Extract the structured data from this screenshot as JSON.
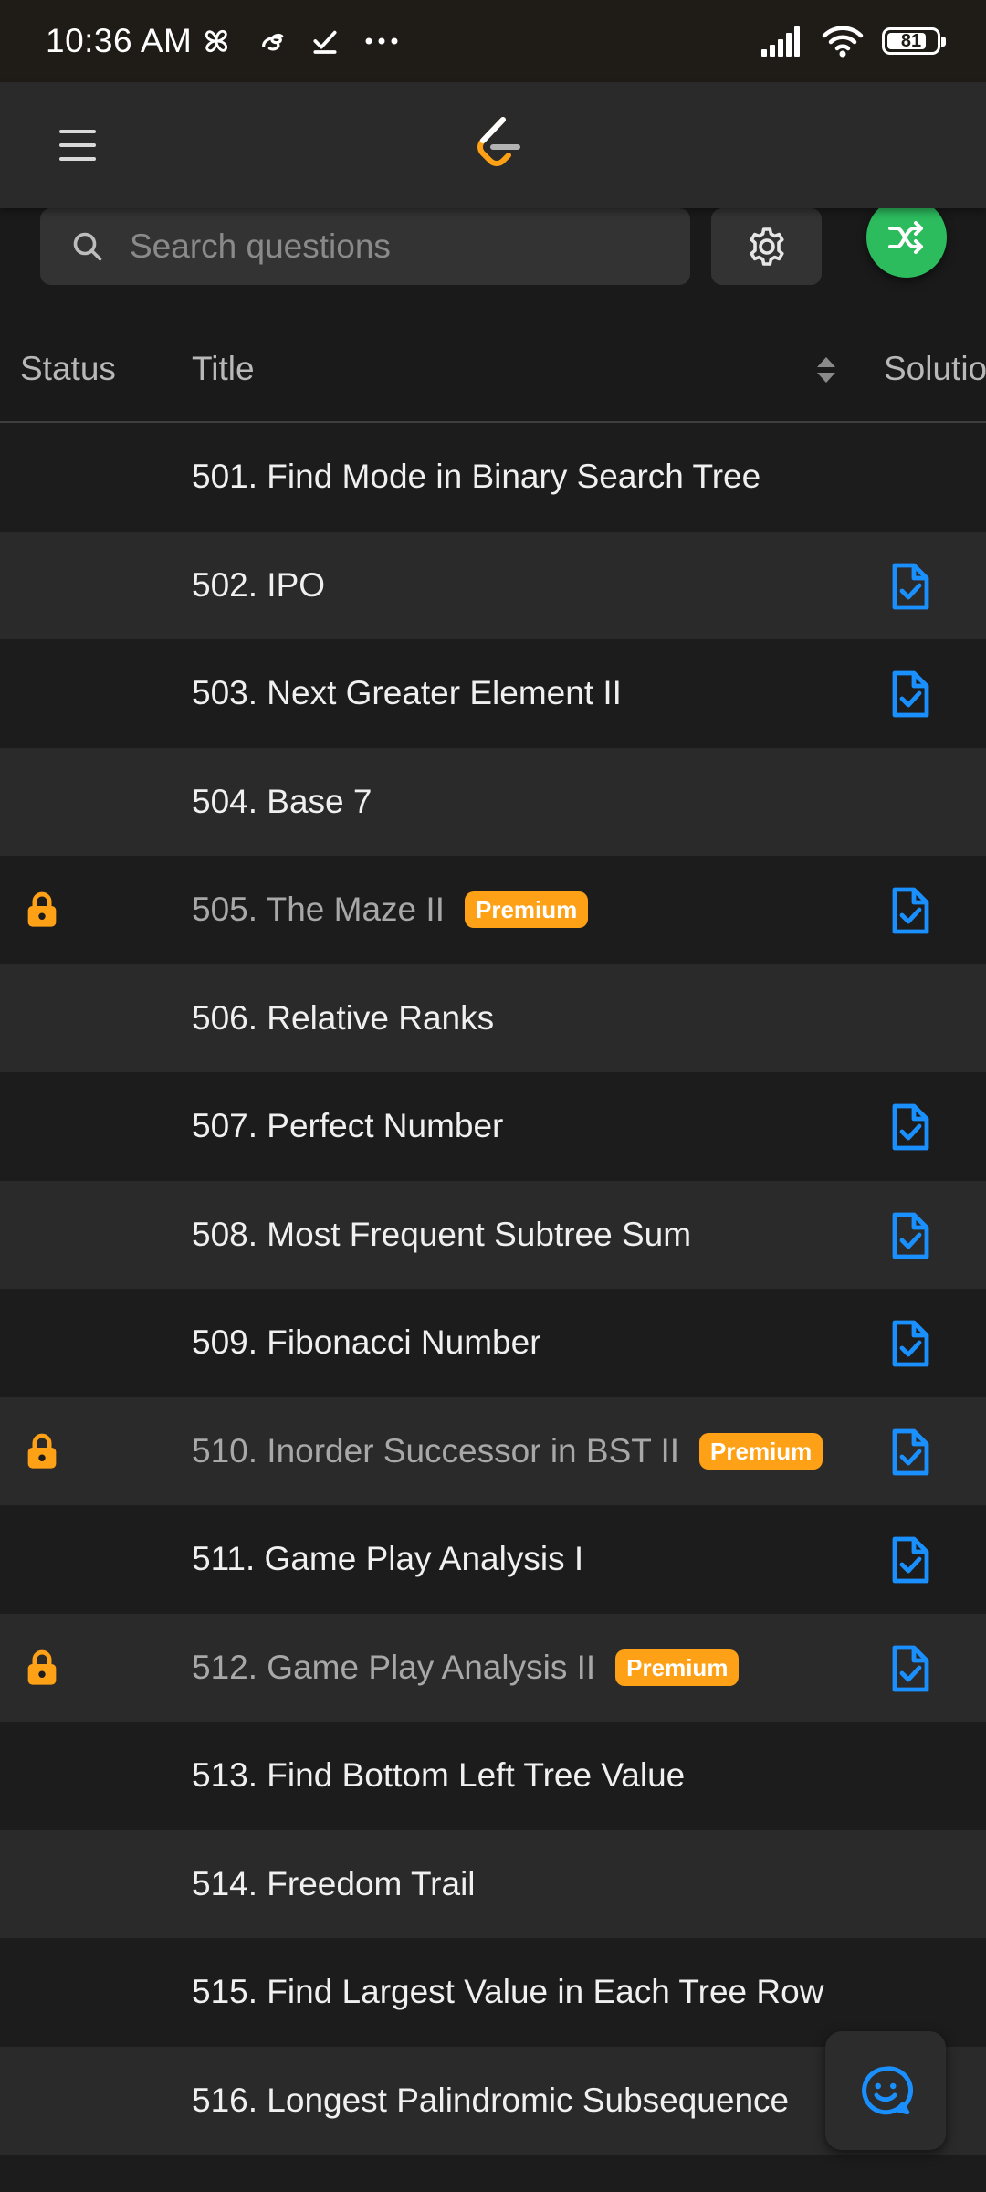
{
  "status_bar": {
    "time": "10:36 AM",
    "battery_level": "81",
    "battery_fraction": 0.81,
    "icons": [
      "pinwheel-icon",
      "swirl-icon",
      "checklist-icon",
      "more-dots-icon",
      "signal-icon",
      "wifi-icon",
      "battery-icon"
    ]
  },
  "app_bar": {
    "menu_icon": "hamburger-menu-icon",
    "logo_icon": "leetcode-logo-icon"
  },
  "search": {
    "placeholder": "Search questions",
    "value": "",
    "icon": "search-icon",
    "settings_icon": "gear-icon",
    "shuffle_icon": "shuffle-icon"
  },
  "table": {
    "headers": {
      "status": "Status",
      "title": "Title",
      "solution": "Solutio"
    },
    "rows": [
      {
        "title": "501. Find Mode in Binary Search Tree",
        "locked": false,
        "premium": "",
        "solution": false
      },
      {
        "title": "502. IPO",
        "locked": false,
        "premium": "",
        "solution": true
      },
      {
        "title": "503. Next Greater Element II",
        "locked": false,
        "premium": "",
        "solution": true
      },
      {
        "title": "504. Base 7",
        "locked": false,
        "premium": "",
        "solution": false
      },
      {
        "title": "505. The Maze II",
        "locked": true,
        "premium": "Premium",
        "solution": true
      },
      {
        "title": "506. Relative Ranks",
        "locked": false,
        "premium": "",
        "solution": false
      },
      {
        "title": "507. Perfect Number",
        "locked": false,
        "premium": "",
        "solution": true
      },
      {
        "title": "508. Most Frequent Subtree Sum",
        "locked": false,
        "premium": "",
        "solution": true
      },
      {
        "title": "509. Fibonacci Number",
        "locked": false,
        "premium": "",
        "solution": true
      },
      {
        "title": "510. Inorder Successor in BST II",
        "locked": true,
        "premium": "Premium",
        "solution": true
      },
      {
        "title": "511. Game Play Analysis I",
        "locked": false,
        "premium": "",
        "solution": true
      },
      {
        "title": "512. Game Play Analysis II",
        "locked": true,
        "premium": "Premium",
        "solution": true
      },
      {
        "title": "513. Find Bottom Left Tree Value",
        "locked": false,
        "premium": "",
        "solution": false
      },
      {
        "title": "514. Freedom Trail",
        "locked": false,
        "premium": "",
        "solution": false
      },
      {
        "title": "515. Find Largest Value in Each Tree Row",
        "locked": false,
        "premium": "",
        "solution": false
      },
      {
        "title": "516. Longest Palindromic Subsequence",
        "locked": false,
        "premium": "",
        "solution": false
      }
    ]
  },
  "feedback": {
    "icon": "smiley-chat-icon"
  },
  "colors": {
    "accent_orange": "#ffa116",
    "solution_blue": "#1a90ff",
    "shuffle_green": "#2cbb5d",
    "background": "#1a1a1a"
  }
}
